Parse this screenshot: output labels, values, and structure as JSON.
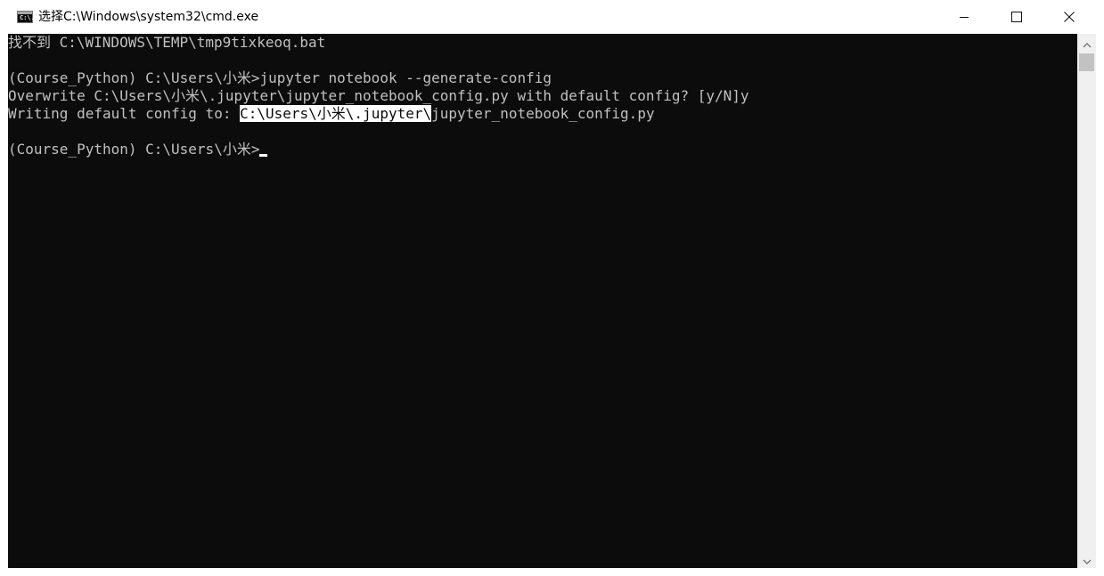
{
  "window": {
    "title": "选择C:\\Windows\\system32\\cmd.exe",
    "icon": "cmd-icon",
    "icon_text": "C:\\.",
    "controls": [
      "minimize-icon",
      "maximize-icon",
      "close-icon"
    ]
  },
  "console": {
    "lines": [
      {
        "text": "找不到 C:\\WINDOWS\\TEMP\\tmp9tixkeoq.bat"
      },
      {
        "text": ""
      },
      {
        "text": "(Course_Python) C:\\Users\\小米>jupyter notebook --generate-config"
      },
      {
        "text": "Overwrite C:\\Users\\小米\\.jupyter\\jupyter_notebook_config.py with default config? [y/N]y"
      },
      {
        "before": "Writing default config to: ",
        "selected": "C:\\Users\\小米\\.jupyter\\",
        "after": "jupyter_notebook_config.py"
      },
      {
        "text": ""
      },
      {
        "text": "(Course_Python) C:\\Users\\小米>"
      }
    ]
  },
  "colors": {
    "console_bg": "#0c0c0c",
    "console_fg": "#c0c0c0",
    "selection_bg": "#ffffff",
    "titlebar_bg": "#ffffff"
  }
}
